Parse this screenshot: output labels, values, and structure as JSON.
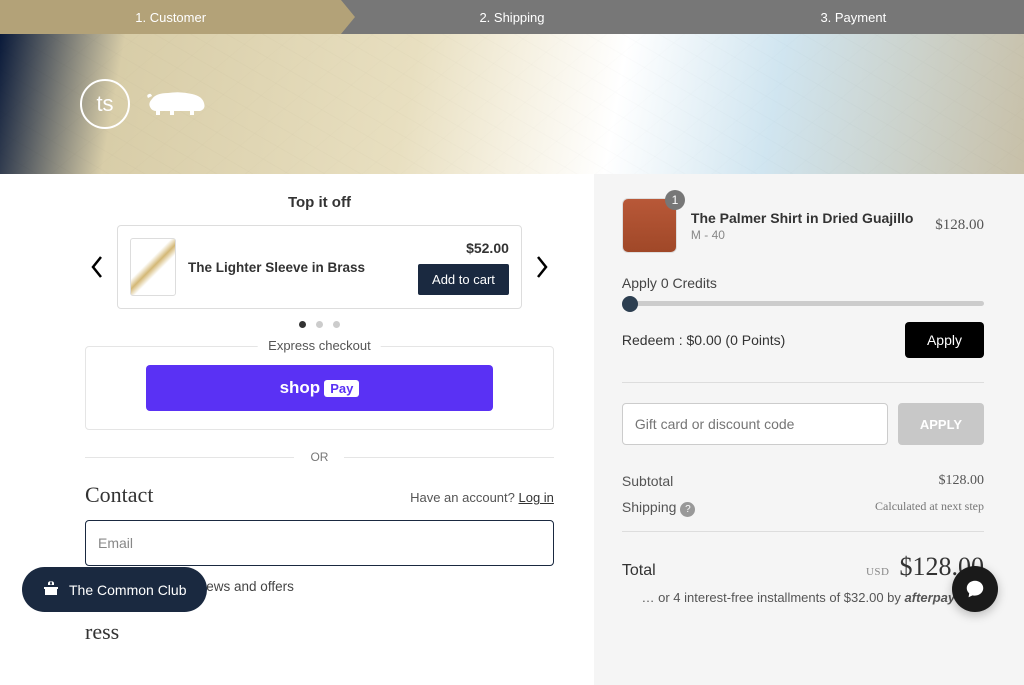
{
  "steps": {
    "s1": "1. Customer",
    "s2": "2. Shipping",
    "s3": "3. Payment"
  },
  "topitoff": {
    "title": "Top it off",
    "item": {
      "name": "The Lighter Sleeve in Brass",
      "price": "$52.00",
      "add": "Add to cart"
    }
  },
  "express": {
    "label": "Express checkout",
    "shop": "shop",
    "pay": "Pay",
    "or": "OR"
  },
  "contact": {
    "title": "Contact",
    "have_account": "Have an account? ",
    "login": "Log in",
    "email_ph": "Email",
    "newsletter": "Email me with news and offers",
    "shipping_partial": "ress"
  },
  "cart": {
    "qty": "1",
    "name": "The Palmer Shirt in Dried Guajillo",
    "variant": "M - 40",
    "price": "$128.00"
  },
  "credits": {
    "label": "Apply 0 Credits",
    "redeem": "Redeem : $0.00 (0 Points)",
    "apply": "Apply"
  },
  "discount": {
    "ph": "Gift card or discount code",
    "apply": "APPLY"
  },
  "summary": {
    "subtotal_label": "Subtotal",
    "subtotal_val": "$128.00",
    "shipping_label": "Shipping",
    "shipping_val": "Calculated at next step",
    "total_label": "Total",
    "currency": "USD",
    "total_val": "$128.00",
    "installments": "… or 4 interest-free installments of $32.00 by ",
    "afterpay": "afterpay"
  },
  "floating": {
    "club": "The Common Club"
  }
}
